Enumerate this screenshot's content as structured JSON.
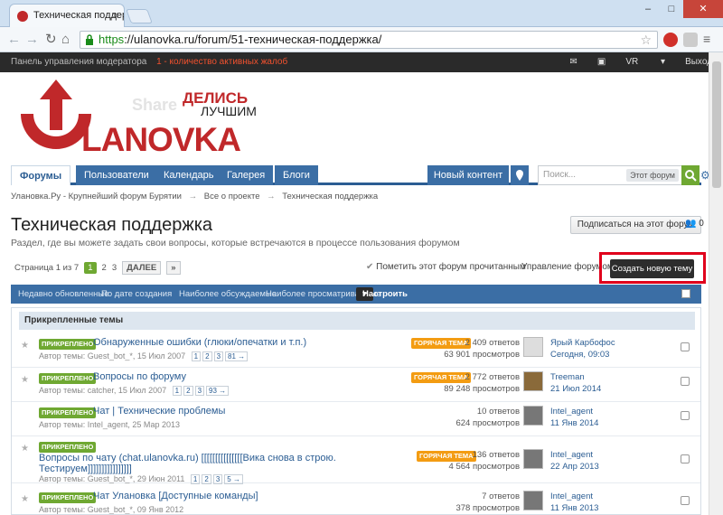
{
  "browser": {
    "tab_title": "Техническая поддержка",
    "url_https": "https",
    "url_rest": "://ulanovka.ru/forum/51-техническая-поддержка/"
  },
  "modbar": {
    "panel": "Панель управления модератора",
    "alert": "1 - количество активных жалоб",
    "user": "VR",
    "logout": "Выход"
  },
  "logo": {
    "text": "LANOVKA",
    "slogan1": "ДЕЛИСЬ",
    "slogan2": "ЛУЧШИМ",
    "ghost": "Share"
  },
  "nav": {
    "tabs": [
      "Форумы",
      "Пользователи",
      "Календарь",
      "Галерея",
      "Блоги"
    ],
    "new_content": "Новый контент",
    "search_placeholder": "Поиск...",
    "search_scope": "Этот форум"
  },
  "breadcrumb": [
    "Уланов­ка.Ру - Крупнейший форум Бурятии",
    "Все о проекте",
    "Техническая поддержка"
  ],
  "page": {
    "title": "Техническая поддержка",
    "description": "Раздел, где вы можете задать свои вопросы, которые встречаются в процессе пользования форумом",
    "subscribe": "Подписаться на этот форум",
    "subscribers": "0"
  },
  "pager": {
    "label": "Страница 1 из 7",
    "pages": [
      "1",
      "2",
      "3"
    ],
    "next": "ДАЛЕЕ",
    "last": "»"
  },
  "actions": {
    "mark_read": "Пометить этот форум прочитанным",
    "manage": "Управление форумом",
    "create": "Создать новую тему"
  },
  "filters": {
    "items": [
      "Недавно обновленные",
      "По дате создания",
      "Наиболее обсуждаемые",
      "Наиболее просматриваемые"
    ],
    "configure": "Настроить"
  },
  "section": {
    "pinned": "Прикрепленные темы"
  },
  "badges": {
    "pinned": "ПРИКРЕПЛЕНО",
    "hot": "ГОРЯЧАЯ ТЕМА"
  },
  "topics": [
    {
      "title": "Обнаруженные ошибки (глюки/опечатки и т.п.)",
      "meta": "Автор темы: Guest_bot_*, 15 Июл 2007",
      "pages": [
        "1",
        "2",
        "3",
        "81 →"
      ],
      "hot": true,
      "replies": "2 409 ответов",
      "views": "63 901 просмотров",
      "last_user": "Ярый Карбофос",
      "last_date": "Сегодня, 09:03"
    },
    {
      "title": "Вопросы по форуму",
      "meta": "Автор темы: catcher, 15 Июл 2007",
      "pages": [
        "1",
        "2",
        "3",
        "93 →"
      ],
      "hot": true,
      "replies": "2 772 ответов",
      "views": "89 248 просмотров",
      "last_user": "Treeman",
      "last_date": "21 Июл 2014"
    },
    {
      "title": "Чат | Технические проблемы",
      "meta": "Автор темы: Intel_agent, 25 Мар 2013",
      "pages": [],
      "hot": false,
      "replies": "10 ответов",
      "views": "624 просмотров",
      "last_user": "Intel_agent",
      "last_date": "11 Янв 2014"
    },
    {
      "title": "Вопросы по чату (chat.ulanovka.ru) [[[[[[[[[[[[[[[Вика снова в строю.",
      "title2": "Тестируем]]]]]]]]]]]]]]]]",
      "meta": "Автор темы: Guest_bot_*, 29 Июн 2011",
      "pages": [
        "1",
        "2",
        "3",
        "5 →"
      ],
      "hot": true,
      "replies": "136 ответов",
      "views": "4 564 просмотров",
      "last_user": "Intel_agent",
      "last_date": "22 Апр 2013"
    },
    {
      "title": "Чат Улановка [Доступные команды]",
      "meta": "Автор темы: Guest_bot_*, 09 Янв 2012",
      "pages": [],
      "hot": false,
      "replies": "7 ответов",
      "views": "378 просмотров",
      "last_user": "Intel_agent",
      "last_date": "11 Янв 2013"
    }
  ]
}
